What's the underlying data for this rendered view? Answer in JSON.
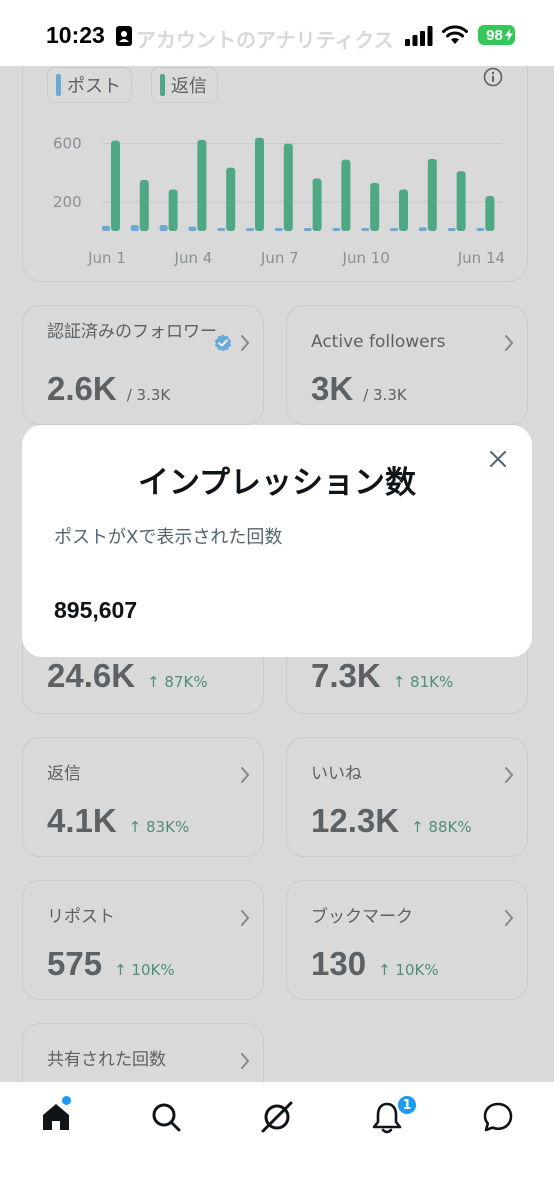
{
  "status_bar": {
    "time": "10:23",
    "battery": "98",
    "behind_title": "アカウントのアナリティクス"
  },
  "chart": {
    "legend": [
      {
        "label": "ポスト",
        "color": "#1d9bf0"
      },
      {
        "label": "返信",
        "color": "#00ba7c"
      }
    ]
  },
  "chart_data": {
    "type": "bar",
    "categories": [
      "Jun 1",
      "Jun 2",
      "Jun 3",
      "Jun 4",
      "Jun 5",
      "Jun 6",
      "Jun 7",
      "Jun 8",
      "Jun 9",
      "Jun 10",
      "Jun 11",
      "Jun 12",
      "Jun 13",
      "Jun 14"
    ],
    "x_tick_labels": [
      "Jun 1",
      "Jun 4",
      "Jun 7",
      "Jun 10",
      "Jun 14"
    ],
    "y_tick_labels": [
      "600",
      "200"
    ],
    "ylim": [
      0,
      700
    ],
    "series": [
      {
        "name": "ポスト",
        "values": [
          35,
          40,
          40,
          30,
          15,
          15,
          10,
          10,
          8,
          10,
          8,
          25,
          15,
          12
        ]
      },
      {
        "name": "返信",
        "values": [
          620,
          350,
          285,
          625,
          435,
          640,
          600,
          360,
          490,
          330,
          285,
          495,
          410,
          240
        ]
      }
    ],
    "grid": true
  },
  "stats": [
    {
      "label": "認証済みのフォロワー",
      "value": "2.6K",
      "sub": "/ 3.3K",
      "verified": true
    },
    {
      "label": "Active followers",
      "value": "3K",
      "sub": "/ 3.3K"
    },
    {
      "label": "",
      "value": "24.6K",
      "delta": "↑ 87K%"
    },
    {
      "label": "",
      "value": "7.3K",
      "delta": "↑ 81K%"
    },
    {
      "label": "返信",
      "value": "4.1K",
      "delta": "↑ 83K%"
    },
    {
      "label": "いいね",
      "value": "12.3K",
      "delta": "↑ 88K%"
    },
    {
      "label": "リポスト",
      "value": "575",
      "delta": "↑ 10K%"
    },
    {
      "label": "ブックマーク",
      "value": "130",
      "delta": "↑ 10K%"
    },
    {
      "label": "共有された回数",
      "value": ""
    }
  ],
  "modal": {
    "title": "インプレッション数",
    "description": "ポストがXで表示された回数",
    "value": "895,607"
  },
  "bottom_nav": {
    "notification_count": "1",
    "items": [
      "home-icon",
      "search-icon",
      "grok-icon",
      "notifications-icon",
      "messages-icon"
    ]
  }
}
